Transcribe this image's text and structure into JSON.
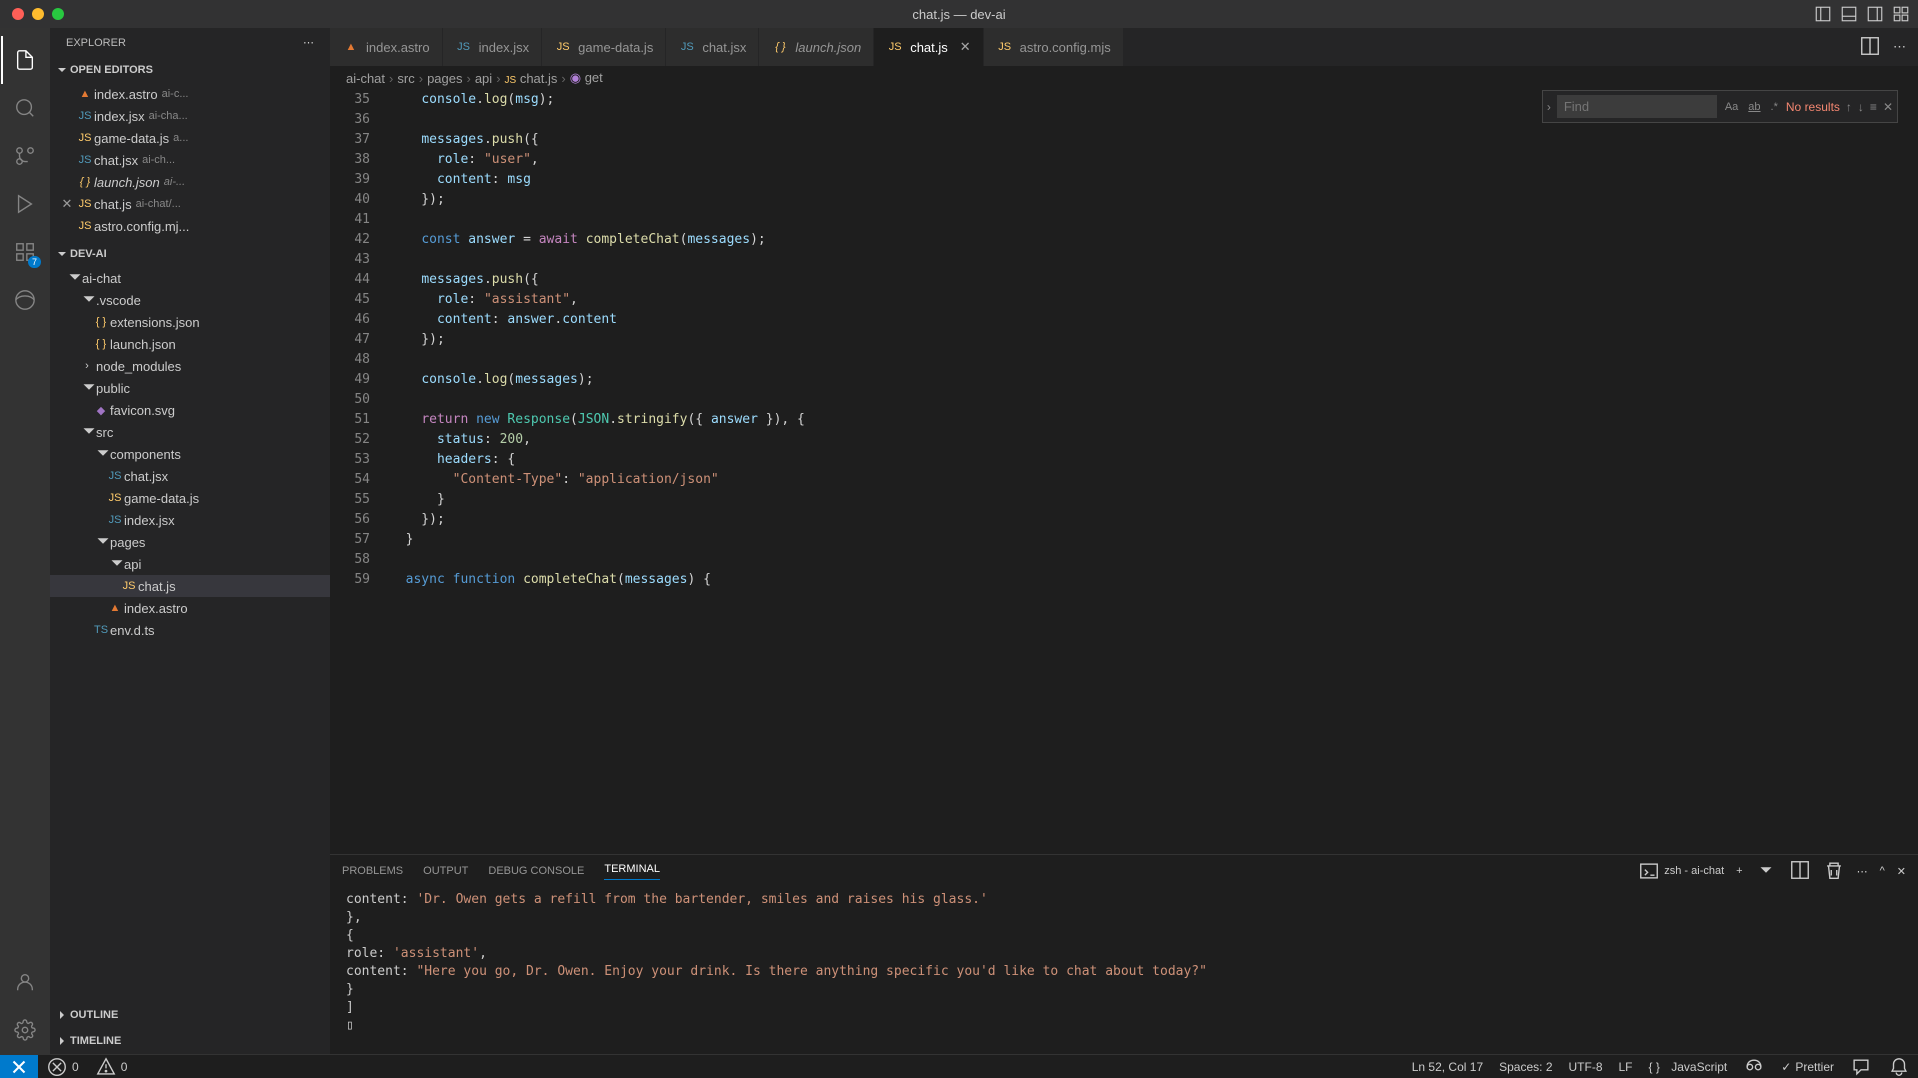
{
  "title": "chat.js — dev-ai",
  "explorer": {
    "title": "EXPLORER"
  },
  "sections": {
    "open_editors": "OPEN EDITORS",
    "project": "DEV-AI",
    "outline": "OUTLINE",
    "timeline": "TIMELINE"
  },
  "activity_badge": "7",
  "open_editors": [
    {
      "icon": "astro",
      "name": "index.astro",
      "desc": "ai-c..."
    },
    {
      "icon": "jsx",
      "name": "index.jsx",
      "desc": "ai-cha..."
    },
    {
      "icon": "js",
      "name": "game-data.js",
      "desc": "a..."
    },
    {
      "icon": "jsx",
      "name": "chat.jsx",
      "desc": "ai-ch..."
    },
    {
      "icon": "json",
      "name": "launch.json",
      "desc": "ai-...",
      "italic": true
    },
    {
      "icon": "js",
      "name": "chat.js",
      "desc": "ai-chat/...",
      "close": true
    },
    {
      "icon": "js",
      "name": "astro.config.mj...",
      "desc": ""
    }
  ],
  "tree": [
    {
      "indent": 1,
      "type": "folder-open",
      "name": "ai-chat"
    },
    {
      "indent": 2,
      "type": "folder-open",
      "name": ".vscode"
    },
    {
      "indent": 3,
      "type": "json",
      "name": "extensions.json"
    },
    {
      "indent": 3,
      "type": "json",
      "name": "launch.json"
    },
    {
      "indent": 2,
      "type": "folder",
      "name": "node_modules"
    },
    {
      "indent": 2,
      "type": "folder-open",
      "name": "public"
    },
    {
      "indent": 3,
      "type": "svg",
      "name": "favicon.svg"
    },
    {
      "indent": 2,
      "type": "folder-open",
      "name": "src"
    },
    {
      "indent": 3,
      "type": "folder-open",
      "name": "components"
    },
    {
      "indent": 4,
      "type": "jsx",
      "name": "chat.jsx"
    },
    {
      "indent": 4,
      "type": "js",
      "name": "game-data.js"
    },
    {
      "indent": 4,
      "type": "jsx",
      "name": "index.jsx"
    },
    {
      "indent": 3,
      "type": "folder-open",
      "name": "pages"
    },
    {
      "indent": 4,
      "type": "folder-open",
      "name": "api"
    },
    {
      "indent": 5,
      "type": "js",
      "name": "chat.js",
      "active": true
    },
    {
      "indent": 4,
      "type": "astro",
      "name": "index.astro"
    },
    {
      "indent": 3,
      "type": "ts",
      "name": "env.d.ts"
    }
  ],
  "tabs": [
    {
      "icon": "astro",
      "name": "index.astro"
    },
    {
      "icon": "jsx",
      "name": "index.jsx"
    },
    {
      "icon": "js",
      "name": "game-data.js"
    },
    {
      "icon": "jsx",
      "name": "chat.jsx"
    },
    {
      "icon": "json",
      "name": "launch.json",
      "italic": true
    },
    {
      "icon": "js",
      "name": "chat.js",
      "active": true,
      "close": true
    },
    {
      "icon": "js",
      "name": "astro.config.mjs"
    }
  ],
  "breadcrumbs": [
    "ai-chat",
    "src",
    "pages",
    "api",
    "chat.js",
    "get"
  ],
  "find": {
    "placeholder": "Find",
    "results": "No results"
  },
  "line_start": 35,
  "code_lines": [
    "    <span class='var'>console</span>.<span class='fn'>log</span>(<span class='var'>msg</span>);",
    "",
    "    <span class='var'>messages</span>.<span class='fn'>push</span>({",
    "      <span class='var'>role</span>: <span class='str'>\"user\"</span>,",
    "      <span class='var'>content</span>: <span class='var'>msg</span>",
    "    });",
    "",
    "    <span class='kw2'>const</span> <span class='var'>answer</span> = <span class='kw'>await</span> <span class='fn'>completeChat</span>(<span class='var'>messages</span>);",
    "",
    "    <span class='var'>messages</span>.<span class='fn'>push</span>({",
    "      <span class='var'>role</span>: <span class='str'>\"assistant\"</span>,",
    "      <span class='var'>content</span>: <span class='var'>answer</span>.<span class='var'>content</span>",
    "    });",
    "",
    "    <span class='var'>console</span>.<span class='fn'>log</span>(<span class='var'>messages</span>);",
    "",
    "    <span class='kw'>return</span> <span class='kw2'>new</span> <span class='cls'>Response</span>(<span class='cls'>JSON</span>.<span class='fn'>stringify</span>({ <span class='var'>answer</span> }), {",
    "      <span class='var'>status</span>: <span class='num'>200</span>,",
    "      <span class='var'>headers</span>: {",
    "        <span class='str'>\"Content-Type\"</span>: <span class='str'>\"application/json\"</span>",
    "      }",
    "    });",
    "  }",
    "",
    "  <span class='kw2'>async</span> <span class='kw2'>function</span> <span class='fn'>completeChat</span>(<span class='var'>messages</span>) {"
  ],
  "panel": {
    "tabs": [
      "PROBLEMS",
      "OUTPUT",
      "DEBUG CONSOLE",
      "TERMINAL"
    ],
    "active_tab": 3,
    "terminal_label": "zsh - ai-chat"
  },
  "terminal_lines": [
    "    content: <span class='str'>'Dr. Owen gets a refill from the bartender, smiles and raises his glass.'</span>",
    "  },",
    "  {",
    "    role: <span class='str'>'assistant'</span>,",
    "    content: <span class='str'>\"Here you go, Dr. Owen. Enjoy your drink. Is there anything specific you'd like to chat about today?\"</span>",
    "  }",
    "]",
    "▯"
  ],
  "statusbar": {
    "errors": "0",
    "warnings": "0",
    "cursor": "Ln 52, Col 17",
    "spaces": "Spaces: 2",
    "encoding": "UTF-8",
    "eol": "LF",
    "lang": "JavaScript",
    "prettier": "Prettier"
  }
}
